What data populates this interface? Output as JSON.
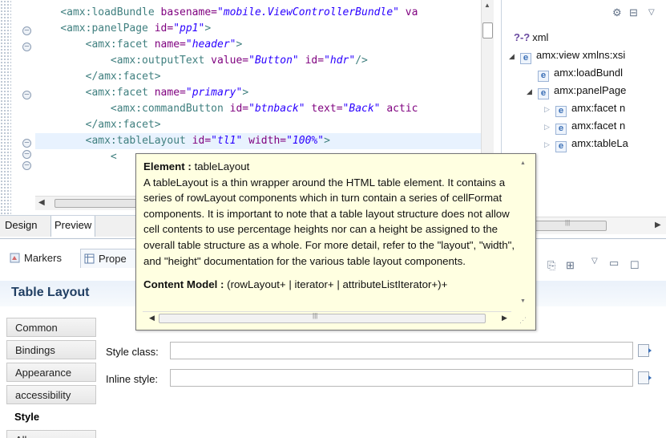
{
  "editor": {
    "lines": [
      {
        "indent": "    ",
        "tag": "<amx:loadBundle",
        "parts": [
          {
            "attr": " basename=",
            "val": "\"mobile.ViewControllerBundle\""
          },
          {
            "attr": " va",
            "val": ""
          }
        ]
      },
      {
        "indent": "    ",
        "tag": "<amx:panelPage",
        "parts": [
          {
            "attr": " id=",
            "val": "\"pp1\""
          }
        ],
        "close": ">"
      },
      {
        "indent": "        ",
        "tag": "<amx:facet",
        "parts": [
          {
            "attr": " name=",
            "val": "\"header\""
          }
        ],
        "close": ">"
      },
      {
        "indent": "            ",
        "tag": "<amx:outputText",
        "parts": [
          {
            "attr": " value=",
            "val": "\"Button\""
          },
          {
            "attr": " id=",
            "val": "\"hdr\""
          }
        ],
        "close": "/>"
      },
      {
        "indent": "        ",
        "tag": "</amx:facet>",
        "parts": []
      },
      {
        "indent": "        ",
        "tag": "<amx:facet",
        "parts": [
          {
            "attr": " name=",
            "val": "\"primary\""
          }
        ],
        "close": ">"
      },
      {
        "indent": "            ",
        "tag": "<amx:commandButton",
        "parts": [
          {
            "attr": " id=",
            "val": "\"btnback\""
          },
          {
            "attr": " text=",
            "val": "\"Back\""
          },
          {
            "attr": " actic",
            "val": ""
          }
        ]
      },
      {
        "indent": "        ",
        "tag": "</amx:facet>",
        "parts": []
      },
      {
        "indent": "        ",
        "tag": "<amx:tableLayout",
        "parts": [
          {
            "attr": " id=",
            "val": "\"tl1\""
          },
          {
            "attr": " width=",
            "val": "\"100%\""
          }
        ],
        "close": ">"
      },
      {
        "indent": "            ",
        "tag": "<",
        "parts": []
      }
    ],
    "tabs": [
      "Design",
      "Preview"
    ],
    "selected_tab": "Preview"
  },
  "outline": {
    "items": [
      {
        "label": "xml",
        "kind": "pi",
        "twisty": "",
        "level": 0
      },
      {
        "label": "amx:view xmlns:xsi",
        "kind": "element",
        "twisty": "expanded",
        "level": 0
      },
      {
        "label": "amx:loadBundl",
        "kind": "element",
        "twisty": "",
        "level": 1
      },
      {
        "label": "amx:panelPage",
        "kind": "element",
        "twisty": "expanded",
        "level": 1
      },
      {
        "label": "amx:facet n",
        "kind": "element",
        "twisty": "collapsed",
        "level": 2
      },
      {
        "label": "amx:facet n",
        "kind": "element",
        "twisty": "collapsed",
        "level": 2
      },
      {
        "label": "amx:tableLa",
        "kind": "element",
        "twisty": "collapsed",
        "level": 2
      }
    ],
    "pi_icon_text": "?-?",
    "element_icon_text": "e"
  },
  "properties": {
    "view_tabs": [
      {
        "label": "Markers",
        "icon": "markers-icon"
      },
      {
        "label": "Prope",
        "icon": "properties-icon"
      }
    ],
    "title": "Table Layout",
    "sections": [
      "Common",
      "Bindings",
      "Appearance",
      "accessibility",
      "Style",
      "All"
    ],
    "selected_section": "Style",
    "fields": [
      {
        "label": "Style class:",
        "value": ""
      },
      {
        "label": "Inline style:",
        "value": ""
      }
    ]
  },
  "popup": {
    "element_label": "Element :",
    "element_name": "tableLayout",
    "description": "A tableLayout is a thin wrapper around the HTML table element. It contains a series of rowLayout components which in turn contain a series of cellFormat components. It is important to note that a table layout structure does not allow cell contents to use percentage heights nor can a height be assigned to the overall table structure as a whole. For more detail, refer to the \"layout\", \"width\", and \"height\" documentation for the various table layout components.",
    "content_model_label": "Content Model :",
    "content_model": "(rowLayout+ | iterator+ | attributeListIterator+)+"
  }
}
